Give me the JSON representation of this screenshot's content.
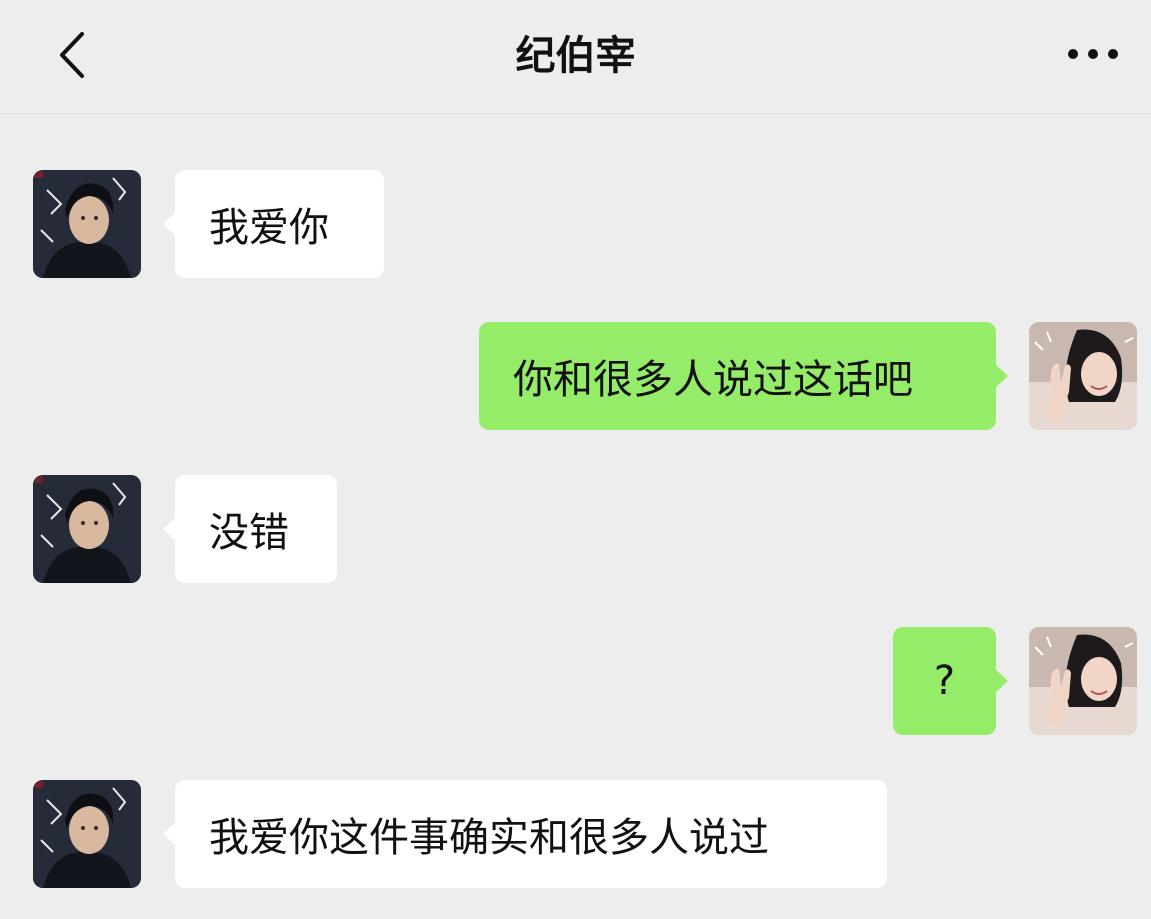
{
  "header": {
    "title": "纪伯宰",
    "back_icon": "chevron-left-icon",
    "more_icon": "more-dots-icon"
  },
  "messages": [
    {
      "side": "left",
      "text": "我爱你"
    },
    {
      "side": "right",
      "text": "你和很多人说过这话吧"
    },
    {
      "side": "left",
      "text": "没错"
    },
    {
      "side": "right",
      "text": "?"
    },
    {
      "side": "left",
      "text": "我爱你这件事确实和很多人说过"
    }
  ],
  "colors": {
    "background": "#ededed",
    "sent_bubble": "#95ec69",
    "received_bubble": "#ffffff"
  }
}
